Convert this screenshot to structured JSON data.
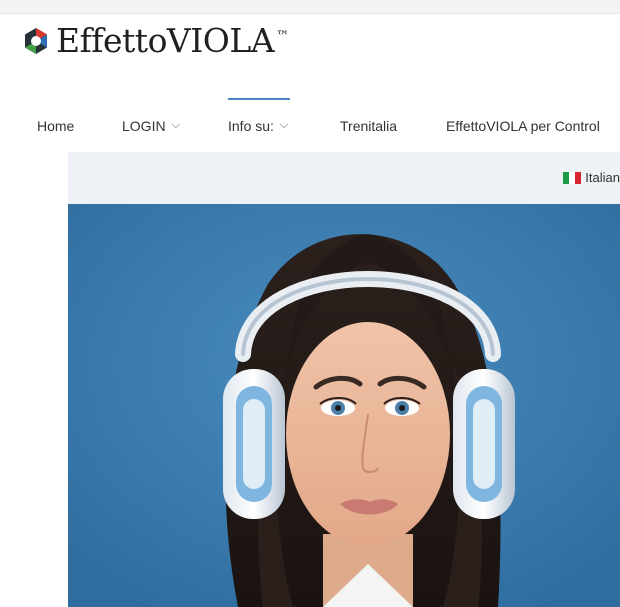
{
  "brand": {
    "name": "EffettoVIOLA",
    "trademark": "™",
    "logo_icon": "hexagon-logo-icon",
    "colors": {
      "red": "#d7392c",
      "blue": "#2e6fb4",
      "green": "#43a047",
      "dark": "#263238"
    }
  },
  "nav": {
    "items": [
      {
        "label": "Home",
        "has_dropdown": false
      },
      {
        "label": "LOGIN",
        "has_dropdown": true
      },
      {
        "label": "Info su:",
        "has_dropdown": true
      },
      {
        "label": "Trenitalia",
        "has_dropdown": false
      },
      {
        "label": "EffettoVIOLA per Control",
        "has_dropdown": false
      }
    ],
    "active_index": 2,
    "accent": "#4b85c2"
  },
  "language": {
    "label": "Italian",
    "flag_colors": [
      "#1e9b48",
      "#ffffff",
      "#d8262f"
    ]
  },
  "hero": {
    "image": "woman-with-headphones-photo",
    "background": "#3f7fb1"
  }
}
